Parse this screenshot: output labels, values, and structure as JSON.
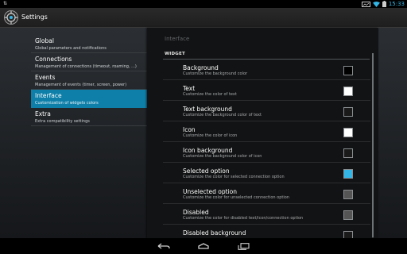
{
  "status_bar": {
    "left_indicator": "⇅",
    "time": "15:33",
    "icons": [
      "landscape-icon",
      "wifi-icon",
      "battery-icon"
    ]
  },
  "action_bar": {
    "title": "Settings",
    "icon": "app-gear-icon"
  },
  "headers": [
    {
      "title": "Global",
      "summary": "Global parameters and notifications",
      "selected": false
    },
    {
      "title": "Connections",
      "summary": "Management of connections (timeout, roaming, ...)",
      "selected": false
    },
    {
      "title": "Events",
      "summary": "Management of events (timer, screen, power)",
      "selected": false
    },
    {
      "title": "Interface",
      "summary": "Customization of widgets colors",
      "selected": true
    },
    {
      "title": "Extra",
      "summary": "Extra compatibility settings",
      "selected": false
    }
  ],
  "detail": {
    "heading": "Interface",
    "section_label": "WIDGET",
    "prefs": [
      {
        "title": "Background",
        "summary": "Customize the background color",
        "color": "#000000"
      },
      {
        "title": "Text",
        "summary": "Customize the color of text",
        "color": "#ffffff"
      },
      {
        "title": "Text background",
        "summary": "Customize the background color of text",
        "color": "#1a1a1a"
      },
      {
        "title": "Icon",
        "summary": "Customize the color of icon",
        "color": "#ffffff"
      },
      {
        "title": "Icon background",
        "summary": "Customize the background color of icon",
        "color": "#1a1a1a"
      },
      {
        "title": "Selected option",
        "summary": "Customize the color for selected connection option",
        "color": "#33b5e5"
      },
      {
        "title": "Unselected option",
        "summary": "Customize the color for unselected connection option",
        "color": "#555555"
      },
      {
        "title": "Disabled",
        "summary": "Customize the color for disabled text/icon/connection option",
        "color": "#555555"
      },
      {
        "title": "Disabled background",
        "summary": "",
        "color": "#1a1a1a"
      }
    ]
  },
  "nav_bar": {
    "buttons": [
      "back-icon",
      "home-icon",
      "recent-apps-icon"
    ]
  },
  "colors": {
    "accent": "#33b5e5",
    "selected_header": "#0e7fa9"
  }
}
